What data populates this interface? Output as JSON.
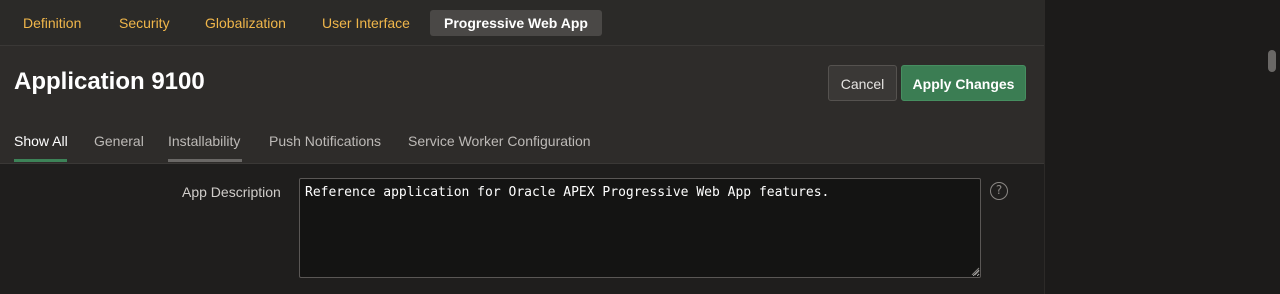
{
  "top_tabs": [
    {
      "label": "Definition",
      "active": false
    },
    {
      "label": "Security",
      "active": false
    },
    {
      "label": "Globalization",
      "active": false
    },
    {
      "label": "User Interface",
      "active": false
    },
    {
      "label": "Progressive Web App",
      "active": true
    }
  ],
  "header": {
    "title": "Application 9100",
    "cancel_label": "Cancel",
    "apply_label": "Apply Changes"
  },
  "sub_tabs": [
    {
      "label": "Show All",
      "active": true
    },
    {
      "label": "General",
      "active": false
    },
    {
      "label": "Installability",
      "active": false
    },
    {
      "label": "Push Notifications",
      "active": false
    },
    {
      "label": "Service Worker Configuration",
      "active": false
    }
  ],
  "form": {
    "app_description_label": "App Description",
    "app_description_value": "Reference application for Oracle APEX Progressive Web App features.",
    "help_icon_glyph": "?"
  },
  "colors": {
    "accent_tab_text": "#f0b64a",
    "primary_button": "#3b7d53",
    "active_underline": "#3d8358"
  },
  "icons": {
    "help": "help-icon",
    "resize": "resize-grip-icon"
  }
}
